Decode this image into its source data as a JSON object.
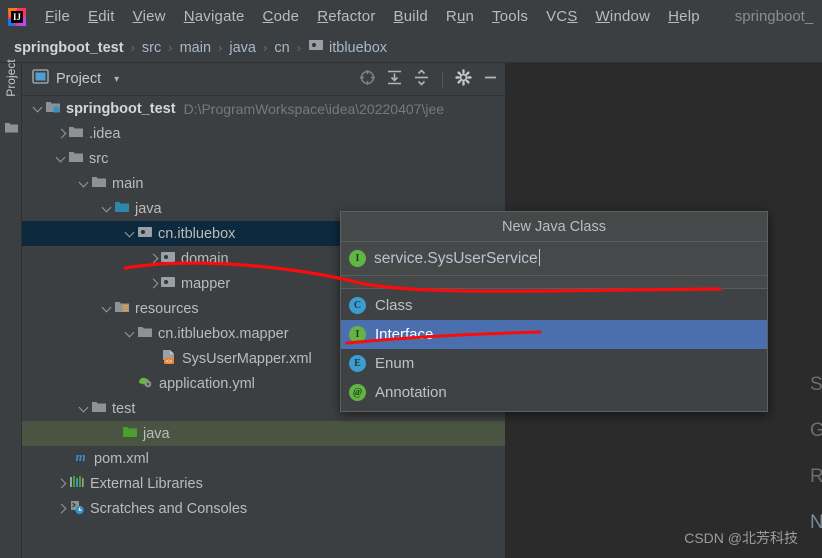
{
  "window": {
    "title": "springboot_",
    "app_icon": "intellij-idea-logo"
  },
  "menubar": {
    "items": [
      {
        "label": "File",
        "mnemonic": "F"
      },
      {
        "label": "Edit",
        "mnemonic": "E"
      },
      {
        "label": "View",
        "mnemonic": "V"
      },
      {
        "label": "Navigate",
        "mnemonic": "N"
      },
      {
        "label": "Code",
        "mnemonic": "C"
      },
      {
        "label": "Refactor",
        "mnemonic": "R"
      },
      {
        "label": "Build",
        "mnemonic": "B"
      },
      {
        "label": "Run",
        "mnemonic": "u"
      },
      {
        "label": "Tools",
        "mnemonic": "T"
      },
      {
        "label": "VCS",
        "mnemonic": "S"
      },
      {
        "label": "Window",
        "mnemonic": "W"
      },
      {
        "label": "Help",
        "mnemonic": "H"
      }
    ]
  },
  "breadcrumb": {
    "separator": "›",
    "items": [
      {
        "label": "springboot_test",
        "bold": true,
        "icon": null
      },
      {
        "label": "src",
        "bold": false,
        "icon": null
      },
      {
        "label": "main",
        "bold": false,
        "icon": null
      },
      {
        "label": "java",
        "bold": false,
        "icon": null
      },
      {
        "label": "cn",
        "bold": false,
        "icon": null
      },
      {
        "label": "itbluebox",
        "bold": false,
        "icon": "package-icon"
      }
    ]
  },
  "left_strip": {
    "tab_label": "Project",
    "folder_icon": "folder-icon"
  },
  "tool_window": {
    "title": "Project",
    "dropdown_caret": "▾",
    "actions": [
      {
        "name": "select-opened-file-icon",
        "tooltip": "Select Opened File"
      },
      {
        "name": "expand-all-icon",
        "tooltip": "Expand All"
      },
      {
        "name": "collapse-all-icon",
        "tooltip": "Collapse All"
      },
      {
        "name": "settings-gear-icon",
        "tooltip": "Settings"
      },
      {
        "name": "hide-icon",
        "tooltip": "Hide"
      }
    ]
  },
  "project_tree": {
    "rows": [
      {
        "indent": 0,
        "arrow": "down",
        "icon": "project-module-icon",
        "label": "springboot_test",
        "bold": true,
        "path": "D:\\ProgramWorkspace\\idea\\20220407\\jee",
        "highlight": "none"
      },
      {
        "indent": 1,
        "arrow": "right",
        "icon": "folder-icon",
        "label": ".idea",
        "bold": false,
        "path": "",
        "highlight": "none"
      },
      {
        "indent": 1,
        "arrow": "down",
        "icon": "folder-icon",
        "label": "src",
        "bold": false,
        "path": "",
        "highlight": "none"
      },
      {
        "indent": 2,
        "arrow": "down",
        "icon": "folder-icon",
        "label": "main",
        "bold": false,
        "path": "",
        "highlight": "none"
      },
      {
        "indent": 3,
        "arrow": "down",
        "icon": "source-root-icon",
        "label": "java",
        "bold": false,
        "path": "",
        "highlight": "none"
      },
      {
        "indent": 4,
        "arrow": "down",
        "icon": "package-icon",
        "label": "cn.itbluebox",
        "bold": false,
        "path": "",
        "highlight": "blue"
      },
      {
        "indent": 5,
        "arrow": "right",
        "icon": "package-icon",
        "label": "domain",
        "bold": false,
        "path": "",
        "highlight": "none"
      },
      {
        "indent": 5,
        "arrow": "right",
        "icon": "package-icon",
        "label": "mapper",
        "bold": false,
        "path": "",
        "highlight": "none"
      },
      {
        "indent": 3,
        "arrow": "down",
        "icon": "resource-root-icon",
        "label": "resources",
        "bold": false,
        "path": "",
        "highlight": "none"
      },
      {
        "indent": 4,
        "arrow": "down",
        "icon": "folder-icon",
        "label": "cn.itbluebox.mapper",
        "bold": false,
        "path": "",
        "highlight": "none"
      },
      {
        "indent": 5,
        "arrow": "none",
        "icon": "xml-file-icon",
        "label": "SysUserMapper.xml",
        "bold": false,
        "path": "",
        "highlight": "none"
      },
      {
        "indent": 4,
        "arrow": "none",
        "icon": "yml-file-icon",
        "label": "application.yml",
        "bold": false,
        "path": "",
        "highlight": "none"
      },
      {
        "indent": 2,
        "arrow": "down",
        "icon": "folder-icon",
        "label": "test",
        "bold": false,
        "path": "",
        "highlight": "none"
      },
      {
        "indent": 3,
        "arrow": "none",
        "icon": "test-source-root-icon",
        "label": "java",
        "bold": false,
        "path": "",
        "highlight": "green"
      },
      {
        "indent": 1,
        "arrow": "none",
        "icon": "maven-file-icon",
        "label": "pom.xml",
        "bold": false,
        "path": "",
        "highlight": "none"
      },
      {
        "indent": 0,
        "arrow": "right",
        "icon": "libraries-icon",
        "label": "External Libraries",
        "bold": false,
        "path": "",
        "highlight": "none"
      },
      {
        "indent": 0,
        "arrow": "right",
        "icon": "scratches-icon",
        "label": "Scratches and Consoles",
        "bold": false,
        "path": "",
        "highlight": "none"
      }
    ]
  },
  "new_java_class_popup": {
    "title": "New Java Class",
    "input": {
      "value": "service.SysUserService",
      "kind_icon": "interface-badge-icon"
    },
    "options": [
      {
        "label": "Class",
        "badge": "C",
        "badge_color": "teal",
        "selected": false
      },
      {
        "label": "Interface",
        "badge": "I",
        "badge_color": "green",
        "selected": true
      },
      {
        "label": "Enum",
        "badge": "E",
        "badge_color": "teal",
        "selected": false
      },
      {
        "label": "Annotation",
        "badge": "@",
        "badge_color": "green",
        "selected": false
      }
    ]
  },
  "editor": {
    "clipped_menu_letters": [
      "S",
      "G",
      "R",
      "N"
    ],
    "watermark": "CSDN @北芳科技"
  },
  "colors": {
    "window_bg": "#3c3f41",
    "editor_bg": "#2b2b2b",
    "selection_blue": "#0d293e",
    "selection_green": "#4a5443",
    "popup_selection": "#4b6eaf",
    "annotation_red": "#fb0b0b",
    "accent_teal": "#3c9dd0",
    "accent_green": "#62b543"
  }
}
